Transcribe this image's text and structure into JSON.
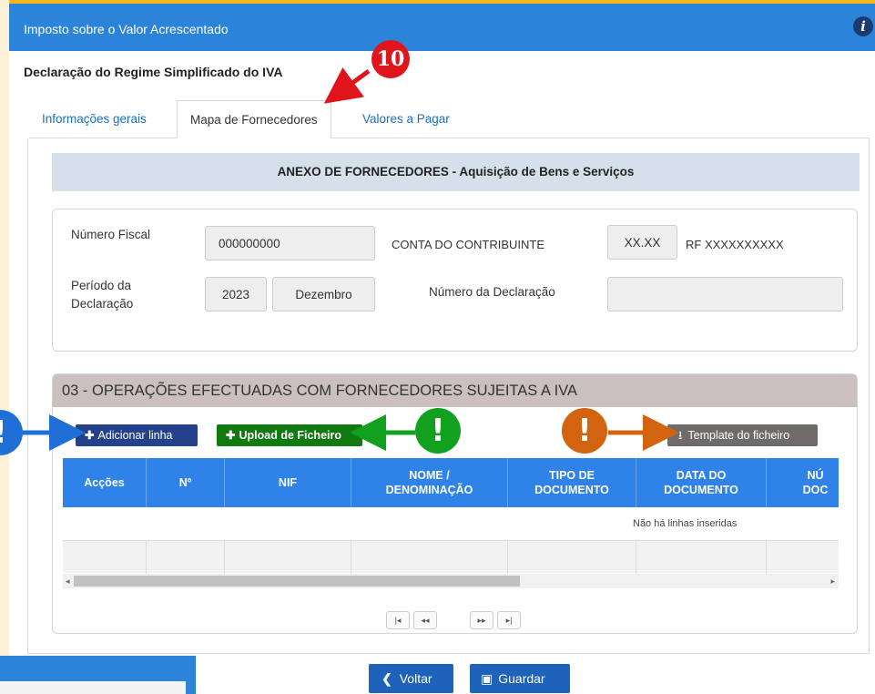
{
  "window": {
    "title": "Imposto sobre o Valor Acrescentado",
    "info_icon": "info-icon"
  },
  "page": {
    "subtitle": "Declaração do Regime Simplificado do IVA"
  },
  "annotations": {
    "step_badge": "10",
    "markers": [
      "!",
      "!",
      "!"
    ]
  },
  "tabs": [
    {
      "label": "Informações gerais"
    },
    {
      "label": "Mapa de Fornecedores"
    },
    {
      "label": "Valores a Pagar"
    }
  ],
  "annex": {
    "header": "ANEXO DE FORNECEDORES - Aquisição de Bens e Serviços"
  },
  "taxpayer": {
    "nif_label": "Número Fiscal",
    "nif_value": "000000000",
    "account_label": "CONTA DO CONTRIBUINTE",
    "account_code": "XX.XX",
    "account_rf": "RF XXXXXXXXXX",
    "period_label_line1": "Período da",
    "period_label_line2": "Declaração",
    "year": "2023",
    "month": "Dezembro",
    "declaration_label": "Número da Declaração",
    "declaration_value": ""
  },
  "operations": {
    "header": "03 - OPERAÇÕES EFECTUADAS COM FORNECEDORES SUJEITAS A IVA",
    "add_button": "Adicionar linha",
    "upload_button": "Upload de Ficheiro",
    "template_button": "Template do ficheiro",
    "columns": [
      {
        "line1": "Acções",
        "line2": ""
      },
      {
        "line1": "Nº",
        "line2": ""
      },
      {
        "line1": "NIF",
        "line2": ""
      },
      {
        "line1": "NOME /",
        "line2": "DENOMINAÇÃO"
      },
      {
        "line1": "TIPO DE",
        "line2": "DOCUMENTO"
      },
      {
        "line1": "DATA DO",
        "line2": "DOCUMENTO"
      },
      {
        "line1": "NÚ",
        "line2": "DOC"
      }
    ],
    "empty_message": "Não há linhas inseridas",
    "pager": [
      "|◂",
      "◂◂",
      "▸▸",
      "▸|"
    ]
  },
  "actions": {
    "back": "Voltar",
    "save": "Guardar"
  },
  "colors": {
    "accent_blue": "#2c84d8",
    "badge_red": "#e0151c",
    "marker_blue": "#1f6fd6",
    "marker_green": "#12a01f",
    "marker_orange": "#d3640f"
  }
}
